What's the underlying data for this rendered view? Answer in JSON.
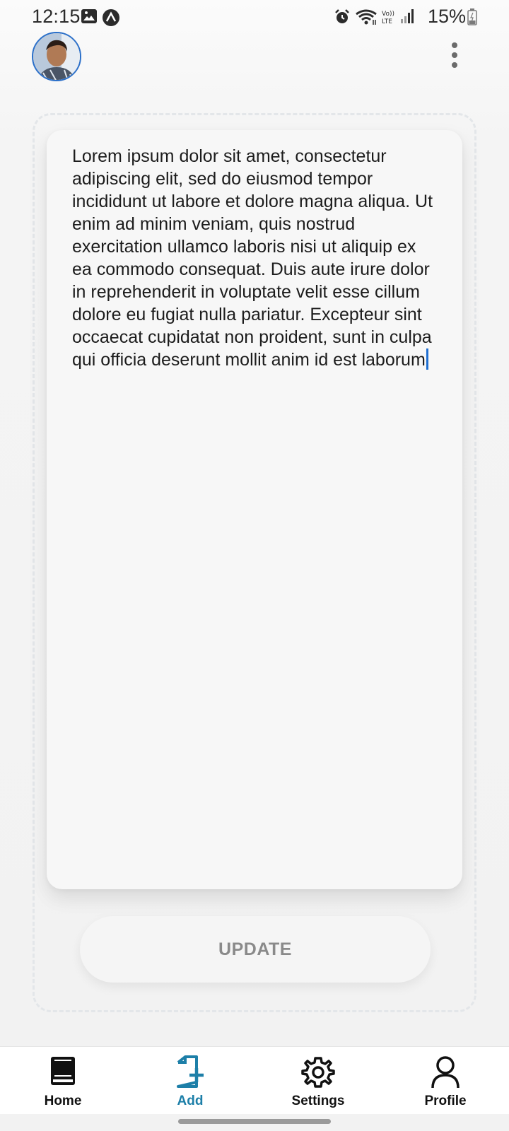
{
  "status_bar": {
    "time": "12:15",
    "battery": "15%",
    "icons": [
      "image-icon",
      "app-notification-icon",
      "alarm-icon",
      "wifi-icon",
      "volte-icon",
      "signal-icon",
      "battery-icon"
    ]
  },
  "header": {
    "avatar": "user-avatar",
    "menu_icon": "more-vertical-icon"
  },
  "editor": {
    "text": "Lorem ipsum dolor sit amet, consectetur adipiscing elit, sed do eiusmod tempor incididunt ut labore et dolore magna aliqua. Ut enim ad minim veniam, quis nostrud exercitation ullamco laboris nisi ut aliquip ex ea commodo consequat. Duis aute irure dolor in reprehenderit in voluptate velit esse cillum dolore eu fugiat nulla pariatur. Excepteur sint occaecat cupidatat non proident, sunt in culpa qui officia deserunt mollit anim id est laborum"
  },
  "actions": {
    "update_label": "UPDATE"
  },
  "bottom_nav": {
    "items": [
      {
        "label": "Home",
        "icon": "book-icon",
        "active": false
      },
      {
        "label": "Add",
        "icon": "add-document-icon",
        "active": true
      },
      {
        "label": "Settings",
        "icon": "gear-icon",
        "active": false
      },
      {
        "label": "Profile",
        "icon": "person-icon",
        "active": false
      }
    ]
  },
  "colors": {
    "accent": "#1d7fa8",
    "cursor": "#1f6fd1",
    "avatar_ring": "#2a6fc9"
  }
}
